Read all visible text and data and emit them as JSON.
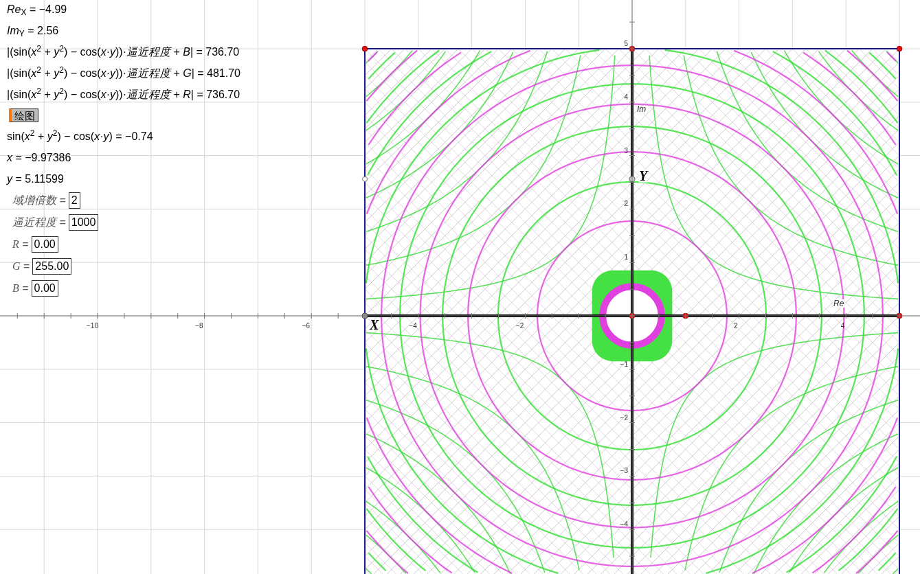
{
  "algebra": [
    {
      "kind": "text",
      "text": "*Re*$_{X}$ = −4.99"
    },
    {
      "kind": "text",
      "text": "*Im*$_{Y}$ = 2.56"
    },
    {
      "kind": "text",
      "text": "|(sin(*x*$^{2}$ + *y*$^{2}$) − cos(*x*·*y*))·*逼近程度* + *B*| = 736.70"
    },
    {
      "kind": "text",
      "text": "|(sin(*x*$^{2}$ + *y*$^{2}$) − cos(*x*·*y*))·*逼近程度* + *G*| = 481.70"
    },
    {
      "kind": "text",
      "text": "|(sin(*x*$^{2}$ + *y*$^{2}$) − cos(*x*·*y*))·*逼近程度* + *R*| = 736.70"
    },
    {
      "kind": "button",
      "label": "绘图"
    },
    {
      "kind": "text",
      "text": "sin(*x*$^{2}$ + *y*$^{2}$) − cos(*x*·*y*) = −0.74"
    },
    {
      "kind": "text",
      "text": "*x* = −9.97386"
    },
    {
      "kind": "text",
      "text": "*y* = 5.11599"
    },
    {
      "kind": "input",
      "label": "*域增倍数* =",
      "value": "2"
    },
    {
      "kind": "input",
      "label": "*逼近程度* =",
      "value": "1000"
    },
    {
      "kind": "input",
      "label": "*R* =",
      "value": "0.00"
    },
    {
      "kind": "input",
      "label": "*G* =",
      "value": "255.00"
    },
    {
      "kind": "input",
      "label": "*B* =",
      "value": "0.00"
    }
  ],
  "x_axis": {
    "label": "Re",
    "ticks": [
      "−10",
      "−8",
      "−6",
      "−4",
      "−2",
      "2",
      "4"
    ]
  },
  "y_axis": {
    "label": "Im",
    "ticks": [
      "5",
      "4",
      "3",
      "2",
      "1",
      "−1",
      "−2",
      "−3",
      "−4"
    ]
  },
  "points": [
    {
      "label": "X"
    },
    {
      "label": "Y"
    }
  ]
}
